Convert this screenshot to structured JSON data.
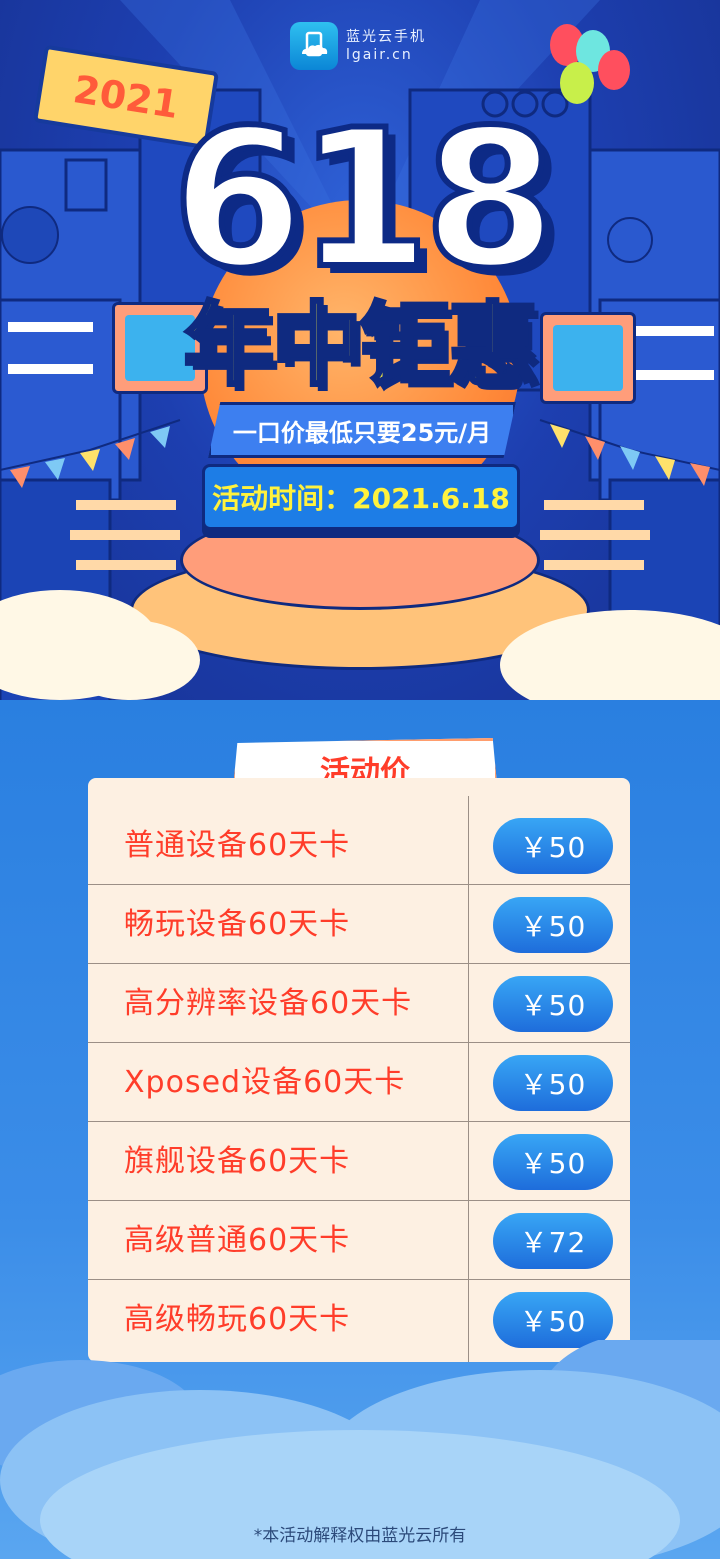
{
  "brand": {
    "logo_name": "蓝光云手机",
    "domain": "lgair.cn"
  },
  "hero": {
    "year_tag": "2021",
    "headline": "618",
    "subtitle": "年中钜惠",
    "price_banner": "一口价最低只要25元/月",
    "event_time": "活动时间：2021.6.18"
  },
  "pricing": {
    "section_title": "活动价",
    "items": [
      {
        "name": "普通设备60天卡",
        "price": "￥50"
      },
      {
        "name": "畅玩设备60天卡",
        "price": "￥50"
      },
      {
        "name": "高分辨率设备60天卡",
        "price": "￥50"
      },
      {
        "name": "Xposed设备60天卡",
        "price": "￥50"
      },
      {
        "name": "旗舰设备60天卡",
        "price": "￥50"
      },
      {
        "name": "高级普通60天卡",
        "price": "￥72"
      },
      {
        "name": "高级畅玩60天卡",
        "price": "￥50"
      }
    ]
  },
  "footer": {
    "note": "*本活动解释权由蓝光云所有"
  },
  "colors": {
    "hero_blue": "#1d3fb0",
    "accent_red": "#ff3d2a",
    "accent_yellow": "#fff23d",
    "button_blue": "#1e6ddb",
    "card_bg": "#fdf0e2"
  }
}
